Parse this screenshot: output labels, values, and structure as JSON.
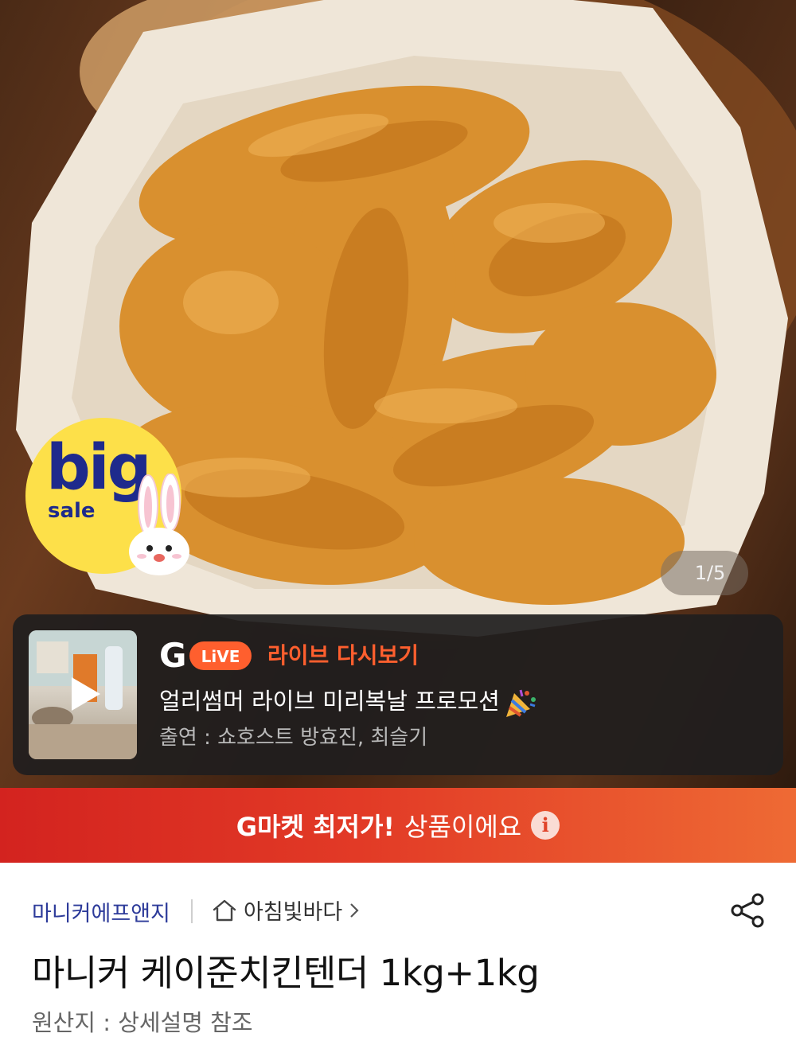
{
  "hero": {
    "slide_counter": "1/5",
    "badge": {
      "big": "big",
      "sale": "sale"
    }
  },
  "live": {
    "logo_g": "G",
    "logo_live": "LiVE",
    "replay_label": "라이브 다시보기",
    "title": "얼리썸머 라이브 미리복날 프로모션",
    "cast": "출연 : 쇼호스트 방효진, 최슬기"
  },
  "price_bar": {
    "strong": "G마켓 최저가!",
    "light": "상품이에요",
    "info_glyph": "i"
  },
  "product": {
    "brand": "마니커에프앤지",
    "store": "아침빛바다",
    "title": "마니커 케이준치킨텐더 1kg+1kg",
    "origin": "원산지 : 상세설명 참조"
  },
  "colors": {
    "accent_orange": "#ff5f2e",
    "price_bar_start": "#d3231f",
    "price_bar_end": "#ee6a34",
    "brand_blue": "#2d3b9a"
  }
}
